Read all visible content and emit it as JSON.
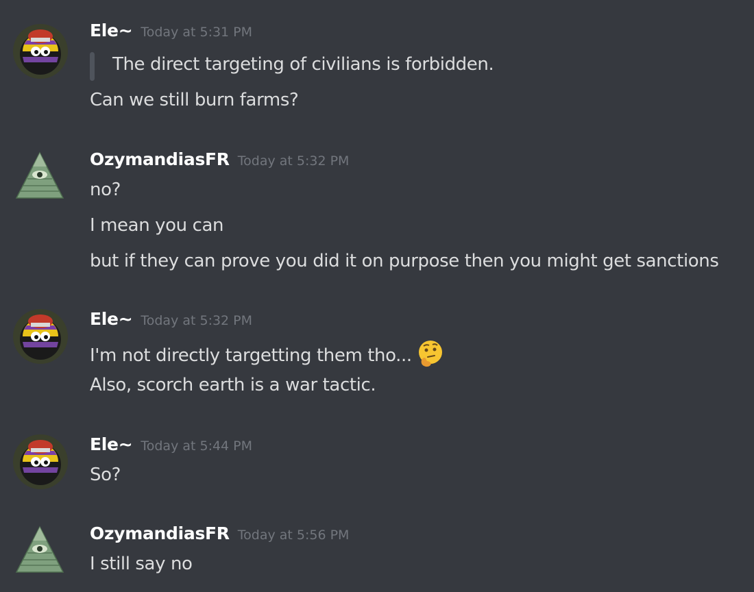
{
  "messages": [
    {
      "username": "Ele~",
      "timestamp": "Today at 5:31 PM",
      "quote": "The direct targeting of civilians is forbidden.",
      "lines": [
        "Can we still burn farms?"
      ]
    },
    {
      "username": "OzymandiasFR",
      "timestamp": "Today at 5:32 PM",
      "lines": [
        "no?",
        "I mean you can",
        "but if they can prove you did it on purpose then you might get sanctions"
      ]
    },
    {
      "username": "Ele~",
      "timestamp": "Today at 5:32 PM",
      "lines": [
        "I'm not directly targetting them tho...",
        "Also, scorch earth is a war tactic."
      ],
      "emoji": "thinking-face-icon"
    },
    {
      "username": "Ele~",
      "timestamp": "Today at 5:44 PM",
      "lines": [
        "So?"
      ]
    },
    {
      "username": "OzymandiasFR",
      "timestamp": "Today at 5:56 PM",
      "lines": [
        "I still say no"
      ]
    }
  ],
  "colors": {
    "background": "#36393f",
    "username": "#ffffff",
    "timestamp": "#72767d",
    "message_text": "#dcddde",
    "quote_bar": "#4f545c"
  }
}
